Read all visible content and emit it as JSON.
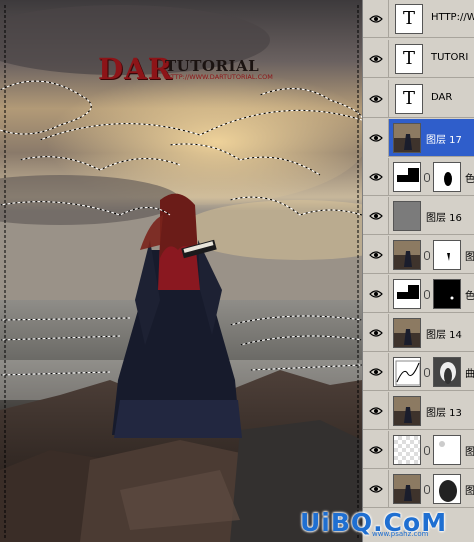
{
  "artwork": {
    "logo_dar": "DAR",
    "logo_tutorial": "TUTORIAL",
    "logo_url": "HTTP://WWW.DARTUTORIAL.COM"
  },
  "layers": [
    {
      "name": "HTTP://W",
      "kind": "text",
      "visible": true,
      "selected": false
    },
    {
      "name": "TUTORI",
      "kind": "text",
      "visible": true,
      "selected": false
    },
    {
      "name": "DAR",
      "kind": "text",
      "visible": true,
      "selected": false
    },
    {
      "name": "图层 17",
      "kind": "image",
      "visible": true,
      "selected": true
    },
    {
      "name": "色",
      "kind": "adjustment-mask",
      "visible": true,
      "selected": false
    },
    {
      "name": "图层 16",
      "kind": "gray",
      "visible": true,
      "selected": false
    },
    {
      "name": "图",
      "kind": "image-mask",
      "visible": true,
      "selected": false
    },
    {
      "name": "色",
      "kind": "adjustment-mask",
      "visible": true,
      "selected": false
    },
    {
      "name": "图层 14",
      "kind": "image",
      "visible": true,
      "selected": false
    },
    {
      "name": "曲",
      "kind": "curves-mask",
      "visible": true,
      "selected": false
    },
    {
      "name": "图层 13",
      "kind": "image",
      "visible": true,
      "selected": false
    },
    {
      "name": "图",
      "kind": "transparent-mask",
      "visible": true,
      "selected": false
    },
    {
      "name": "图",
      "kind": "image-mask",
      "visible": true,
      "selected": false
    }
  ],
  "watermark": {
    "logo": "UiBQ.CoM",
    "url": "www.psahz.com"
  },
  "colors": {
    "panel_bg": "#d4d0c8",
    "selected_row": "#2f5ecb",
    "logo_red": "#8d1418",
    "watermark_blue": "#1f6fd1"
  }
}
